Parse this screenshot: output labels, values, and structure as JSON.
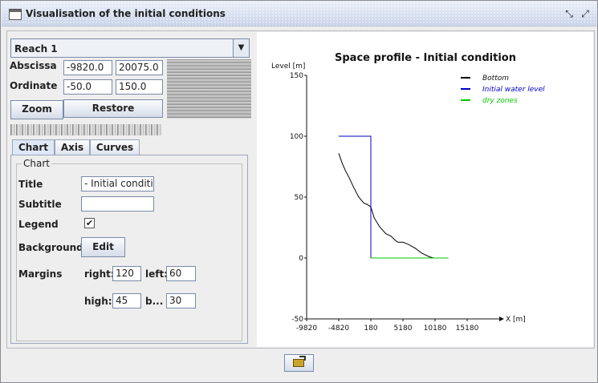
{
  "window": {
    "title": "Visualisation of the initial conditions"
  },
  "reach_combo": {
    "value": "Reach 1"
  },
  "abscissa": {
    "label": "Abscissa",
    "min": "-9820.0",
    "max": "20075.0"
  },
  "ordinate": {
    "label": "Ordinate",
    "min": "-50.0",
    "max": "150.0"
  },
  "buttons": {
    "zoom": "Zoom",
    "restore": "Restore",
    "edit": "Edit"
  },
  "tabs": [
    {
      "label": "Chart"
    },
    {
      "label": "Axis"
    },
    {
      "label": "Curves"
    }
  ],
  "chart_group": {
    "title": "Chart",
    "title_label": "Title",
    "title_value": "- Initial condition",
    "subtitle_label": "Subtitle",
    "subtitle_value": "",
    "legend_label": "Legend",
    "legend_checked": "✔",
    "background_label": "Background",
    "margins_label": "Margins",
    "right_label": "right:",
    "right_value": "120",
    "left_label": "left:",
    "left_value": "60",
    "high_label": "high:",
    "high_value": "45",
    "bottom_label": "b...",
    "bottom_value": "30"
  },
  "colors": {
    "bottom": "#000000",
    "initial_water": "#0000c8",
    "dry": "#00c800"
  },
  "chart_data": {
    "type": "line",
    "title": "Space profile - Initial condition",
    "xlabel": "X [m]",
    "ylabel": "Level [m]",
    "xlim": [
      -9820,
      15180
    ],
    "ylim": [
      -50,
      150
    ],
    "x_ticks": [
      "-9820",
      "-4820",
      "180",
      "5180",
      "10180",
      "15180"
    ],
    "y_ticks": [
      "150",
      "100",
      "50",
      "0",
      "-50"
    ],
    "legend_position": "top-right",
    "series": [
      {
        "name": "Bottom",
        "color": "#000000",
        "points": [
          [
            -4820,
            86
          ],
          [
            -4300,
            78
          ],
          [
            -3800,
            72
          ],
          [
            -3200,
            66
          ],
          [
            -2500,
            58
          ],
          [
            -1700,
            50
          ],
          [
            -900,
            45
          ],
          [
            -400,
            44
          ],
          [
            180,
            42
          ],
          [
            700,
            33
          ],
          [
            1500,
            26
          ],
          [
            2500,
            20
          ],
          [
            3300,
            18
          ],
          [
            4100,
            14
          ],
          [
            4400,
            13
          ],
          [
            5200,
            13
          ],
          [
            6100,
            11
          ],
          [
            7100,
            8
          ],
          [
            8100,
            4
          ],
          [
            9300,
            1
          ],
          [
            9960,
            0
          ]
        ]
      },
      {
        "name": "Initial water level",
        "color": "#0000c8",
        "points": [
          [
            -4820,
            100
          ],
          [
            180,
            100
          ],
          [
            180,
            0
          ]
        ]
      },
      {
        "name": "dry zones",
        "color": "#00c800",
        "points": [
          [
            180,
            0
          ],
          [
            12260,
            0
          ]
        ]
      }
    ]
  }
}
